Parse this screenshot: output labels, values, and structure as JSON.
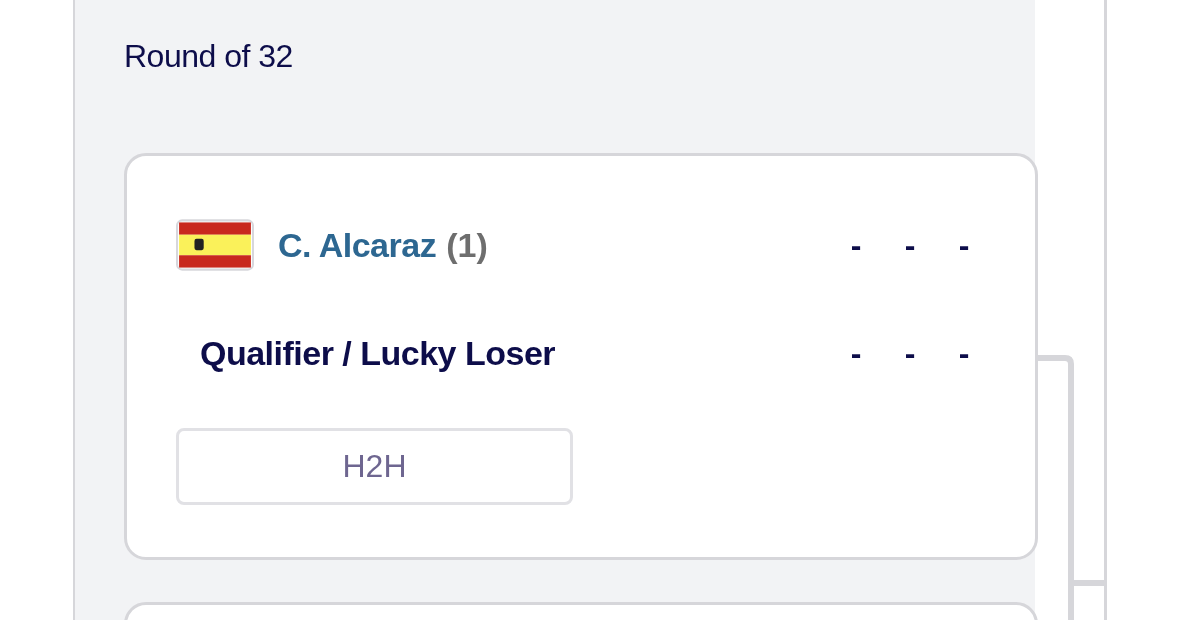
{
  "round": {
    "title": "Round of 32"
  },
  "match": {
    "players": [
      {
        "kind": "seeded",
        "name": "C. Alcaraz",
        "seed": "(1)",
        "scores": [
          "-",
          "-",
          "-"
        ]
      },
      {
        "kind": "qualifier",
        "name": "Qualifier / Lucky Loser",
        "scores": [
          "-",
          "-",
          "-"
        ]
      }
    ],
    "h2h_button": "H2H"
  }
}
